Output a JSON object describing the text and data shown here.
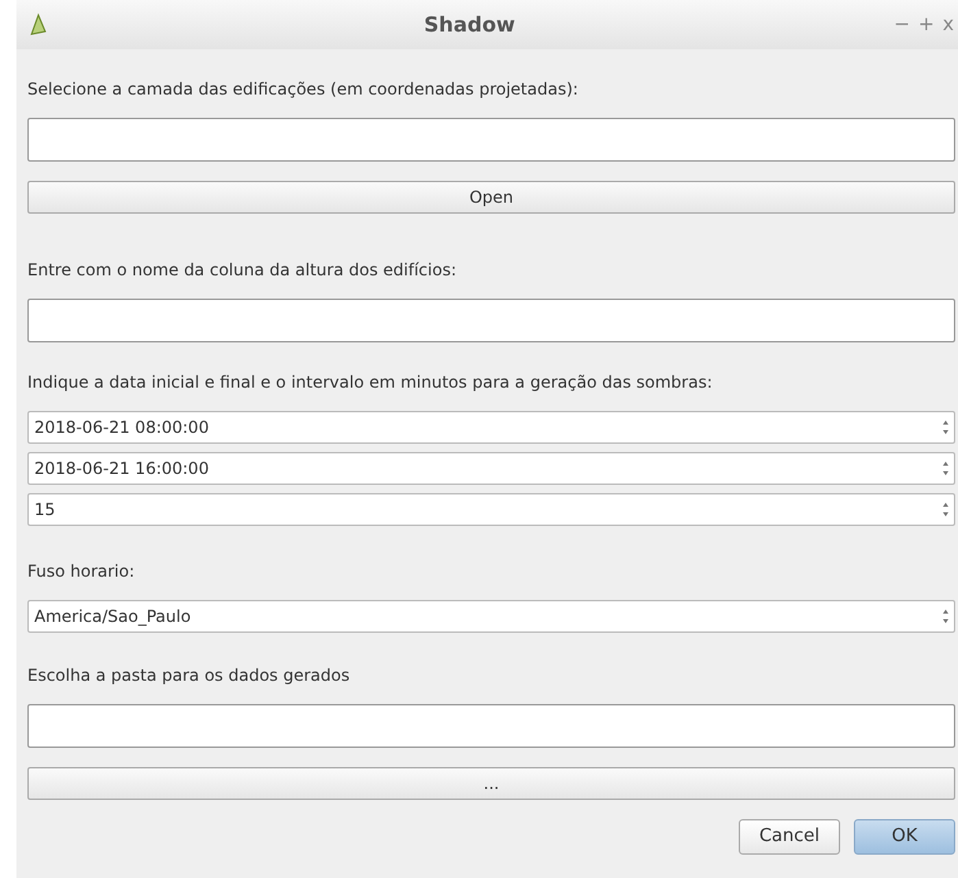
{
  "window": {
    "title": "Shadow",
    "controls": [
      "−",
      "+",
      "x"
    ]
  },
  "items": [
    {
      "kind": "label",
      "text": "Selecione a camada das edificações (em coordenadas projetadas):"
    },
    {
      "kind": "input",
      "value": ""
    },
    {
      "kind": "button",
      "text": "Open"
    },
    {
      "kind": "label",
      "text": "Entre com o nome da coluna da altura dos edifícios:"
    },
    {
      "kind": "input",
      "value": ""
    },
    {
      "kind": "label",
      "text": "Indique a data inicial e final e o intervalo em minutos para a geração das sombras:"
    },
    {
      "kind": "spinbox",
      "value": "2018-06-21 08:00:00"
    },
    {
      "kind": "spinbox",
      "value": "2018-06-21 16:00:00"
    },
    {
      "kind": "spinbox",
      "value": "15"
    },
    {
      "kind": "label",
      "text": "Fuso horario:"
    },
    {
      "kind": "combobox",
      "value": "America/Sao_Paulo"
    },
    {
      "kind": "label",
      "text": "Escolha a pasta para os dados gerados"
    },
    {
      "kind": "input",
      "value": ""
    },
    {
      "kind": "button",
      "text": "..."
    }
  ],
  "buttons": [
    {
      "label": "Cancel",
      "default": false
    },
    {
      "label": "OK",
      "default": true
    }
  ]
}
